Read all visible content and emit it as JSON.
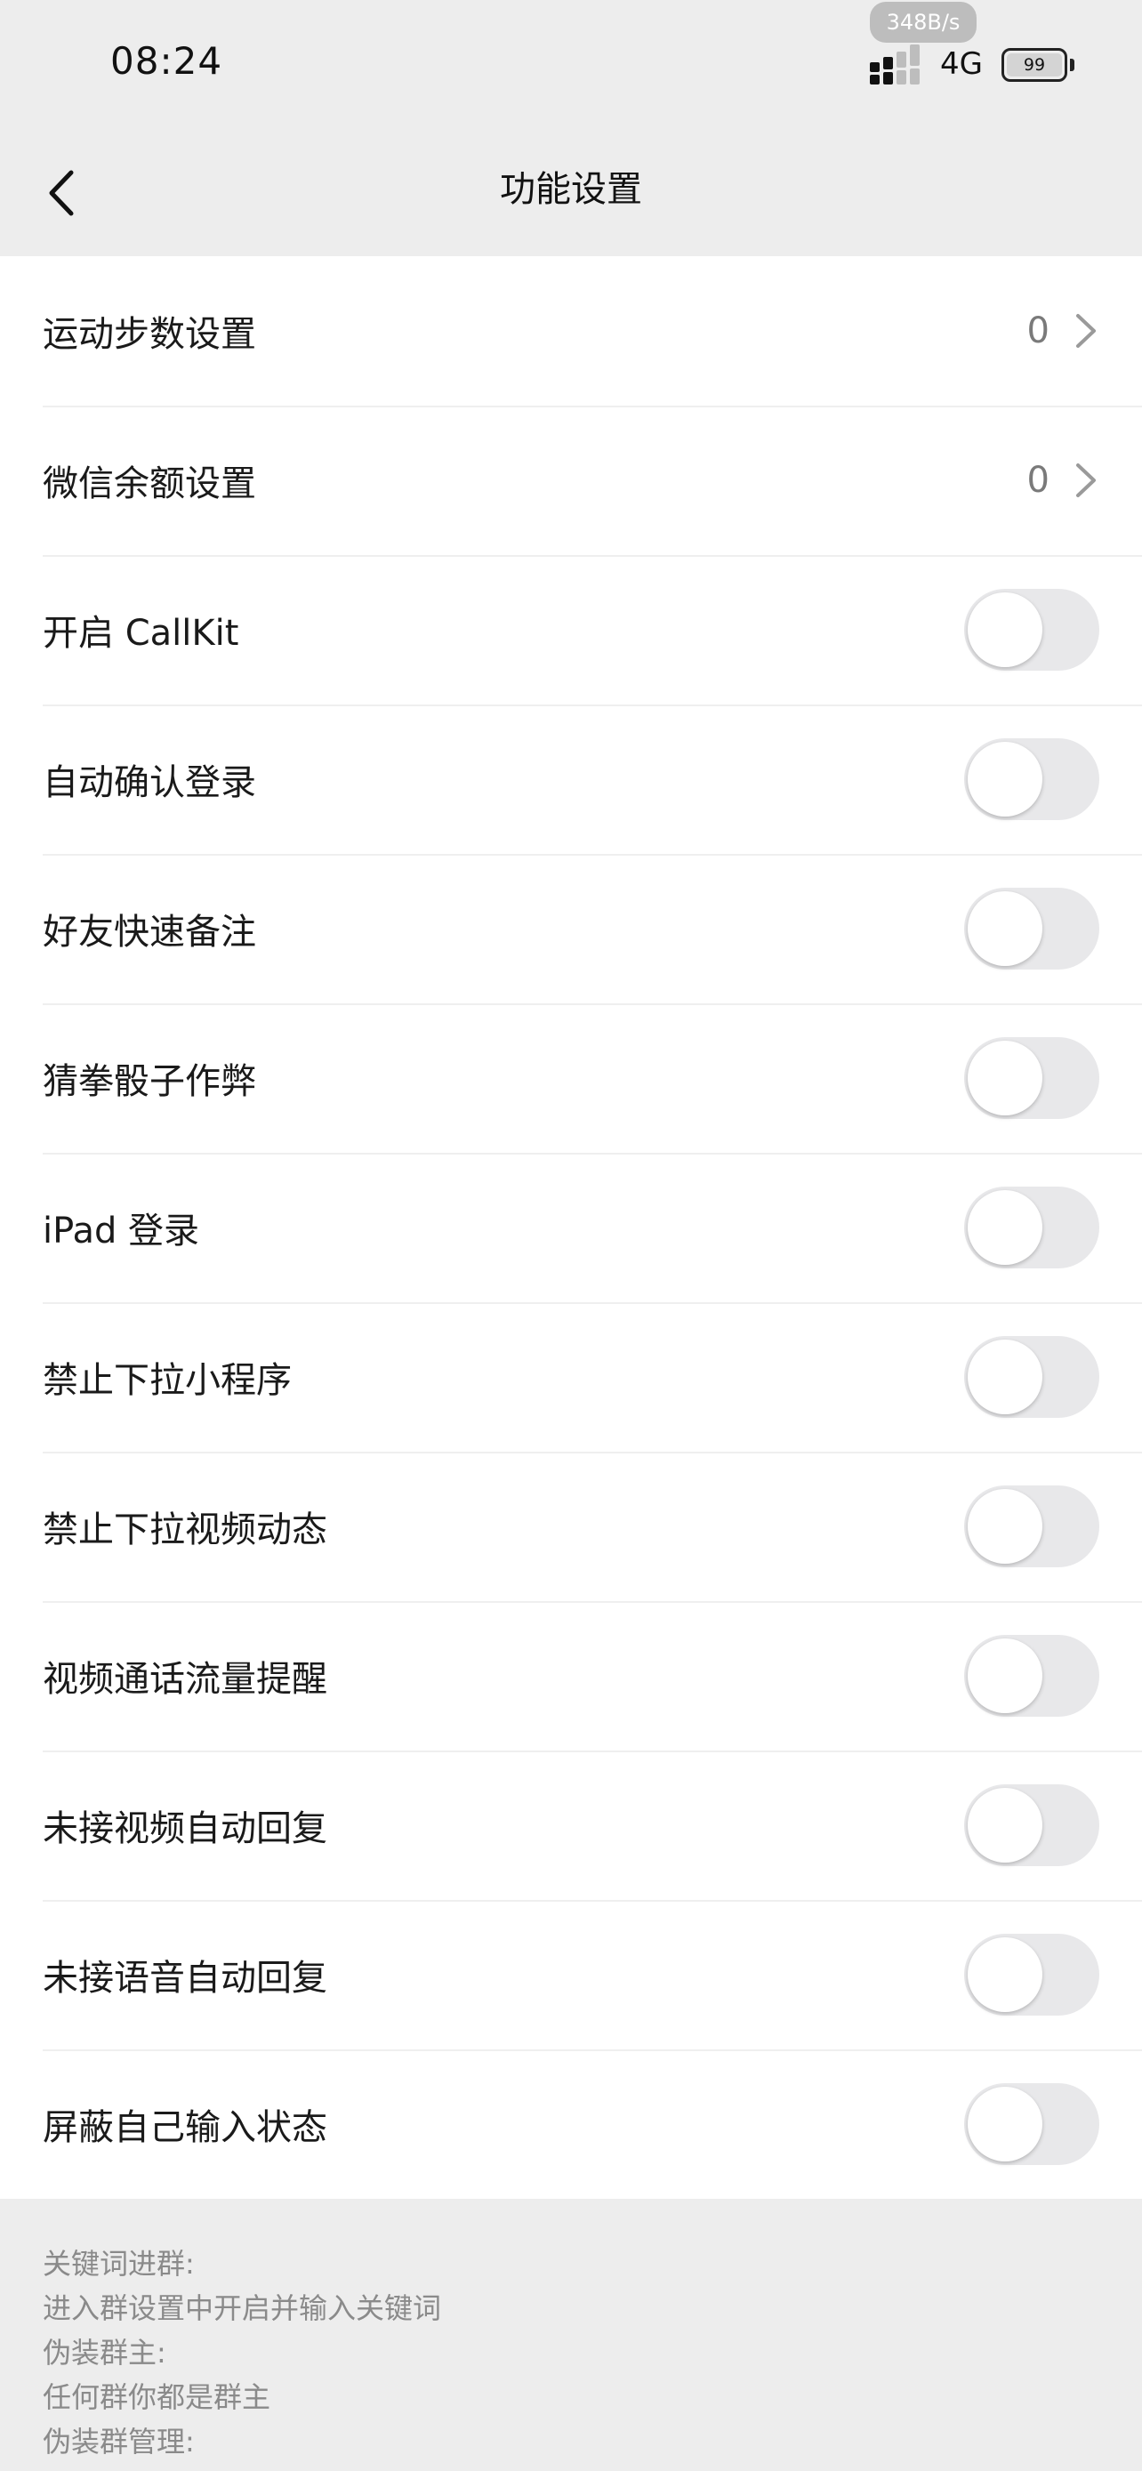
{
  "status_bar": {
    "time": "08:24",
    "net_speed": "348B/s",
    "signal_icon": "cellular-signal-icon",
    "network_type": "4G",
    "battery_level": "99",
    "battery_icon": "battery-icon"
  },
  "nav": {
    "title": "功能设置",
    "back_icon": "chevron-left-icon"
  },
  "settings": {
    "items": [
      {
        "label": "运动步数设置",
        "value": "0"
      },
      {
        "label": "微信余额设置",
        "value": "0"
      },
      {
        "label": "开启 CallKit"
      },
      {
        "label": "自动确认登录"
      },
      {
        "label": "好友快速备注"
      },
      {
        "label": "猜拳骰子作弊"
      },
      {
        "label": "iPad 登录"
      },
      {
        "label": "禁止下拉小程序"
      },
      {
        "label": "禁止下拉视频动态"
      },
      {
        "label": "视频通话流量提醒"
      },
      {
        "label": "未接视频自动回复"
      },
      {
        "label": "未接语音自动回复"
      },
      {
        "label": "屏蔽自己输入状态"
      }
    ]
  },
  "footer": {
    "lines": [
      "关键词进群:",
      "进入群设置中开启并输入关键词",
      "伪装群主:",
      "任何群你都是群主",
      "伪装群管理:"
    ]
  },
  "colors": {
    "page_background": "#ededed",
    "list_background": "#ffffff",
    "toggle_off": "#e8e8ea",
    "secondary_text": "#8a8a8a"
  }
}
